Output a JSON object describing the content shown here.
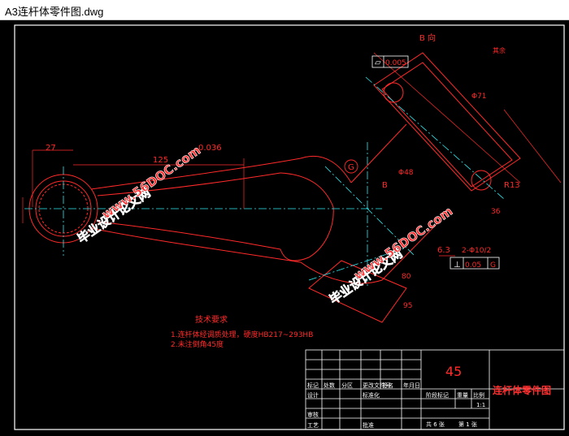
{
  "window": {
    "title": "A3连杆体零件图.dwg"
  },
  "drawing": {
    "section_label": "B 向",
    "roughness_note": "其余",
    "flatness_tolerance": "0.005",
    "perpendicular_tolerance": "0.05",
    "datum_g": "G",
    "datum_b": "B",
    "hole_spec": "2-Φ10/2",
    "dimensions": {
      "d27": "27",
      "d125": "125",
      "d0036": "0.036",
      "d63": "6.3",
      "r13": "R13",
      "d48": "Φ48",
      "d36": "36",
      "dim_a": "Φ71",
      "dim_b": "80",
      "dim_c": "95"
    },
    "tech_requirements": {
      "heading": "技术要求",
      "line1": "1.连杆体经调质处理，硬度HB217~293HB",
      "line2": "2.未注倒角45度"
    },
    "watermarks": [
      "毕业设计论文网",
      "www.56DOC.com"
    ]
  },
  "title_block": {
    "material": "45",
    "part_name": "连杆体零件图",
    "sheets_total": "共 6 张",
    "sheet_num": "第 1 张",
    "scale": "1:1",
    "row_labels": [
      "标记",
      "设计",
      "审核",
      "工艺"
    ],
    "col_labels": [
      "处数",
      "分区",
      "更改文件号",
      "签名",
      "年月日"
    ],
    "stage_labels": [
      "阶段标记",
      "重量",
      "比例"
    ],
    "standardization": "标准化",
    "approve": "批准"
  }
}
